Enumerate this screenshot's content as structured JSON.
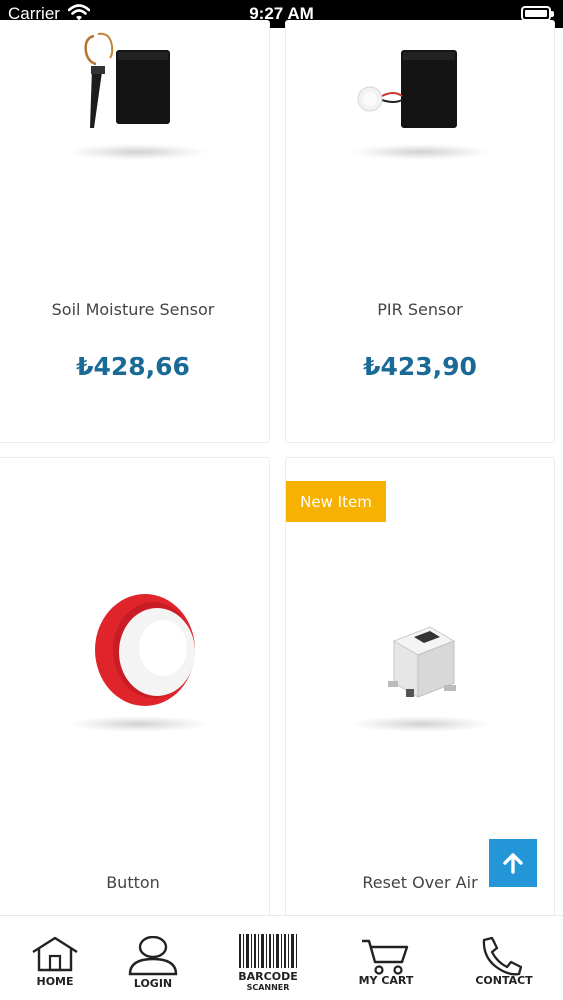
{
  "status_bar": {
    "carrier": "Carrier",
    "time": "9:27 AM"
  },
  "products": [
    {
      "name": "Soil Moisture Sensor",
      "price": "₺428,66"
    },
    {
      "name": "PIR Sensor",
      "price": "₺423,90"
    },
    {
      "name": "Button",
      "badge": ""
    },
    {
      "name": "Reset Over Air",
      "badge": "New Item"
    }
  ],
  "bottom_nav": {
    "home": "HOME",
    "login": "LOGIN",
    "barcode": "BARCODE",
    "barcode_sub": "SCANNER",
    "cart": "MY CART",
    "contact": "CONTACT"
  },
  "colors": {
    "price": "#1a6a98",
    "badge": "#f7b100",
    "scroll_top": "#2496d8"
  }
}
